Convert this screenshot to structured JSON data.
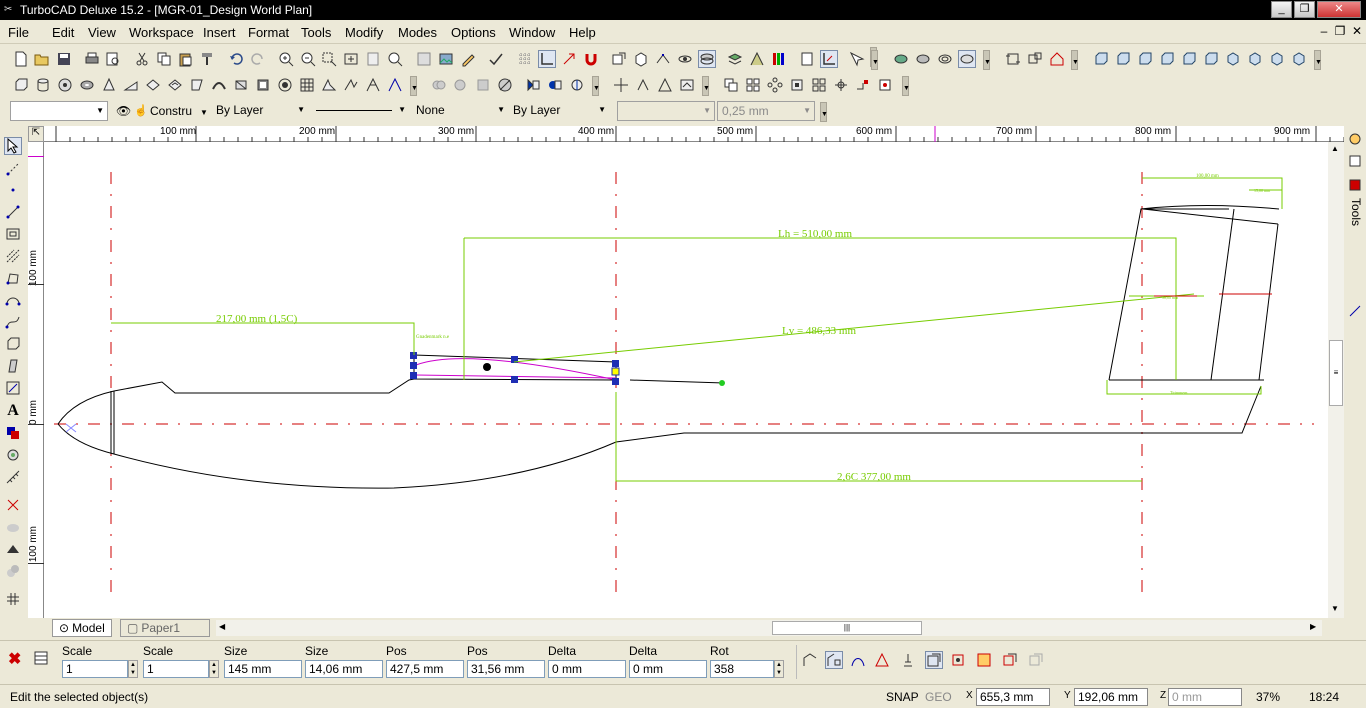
{
  "window": {
    "title": "TurboCAD Deluxe 15.2 - [MGR-01_Design World Plan]",
    "controls": [
      "_",
      "❐",
      "✕"
    ],
    "mdi_controls": [
      "–",
      "❐",
      "✕"
    ]
  },
  "menu": [
    "File",
    "Edit",
    "View",
    "Workspace",
    "Insert",
    "Format",
    "Tools",
    "Modify",
    "Modes",
    "Options",
    "Window",
    "Help"
  ],
  "property_bar": {
    "layer": "",
    "pen_style": "Constru",
    "color": "By Layer",
    "line_type": "",
    "fill": "None",
    "width_mode": "By Layer",
    "combo6": "",
    "width": "0,25 mm"
  },
  "ruler_top": [
    "100 mm",
    "200 mm",
    "300 mm",
    "400 mm",
    "500 mm",
    "600 mm",
    "700 mm",
    "800 mm",
    "900 mm"
  ],
  "ruler_left": [
    "100 mm",
    "0 mm",
    "100 mm"
  ],
  "drawing": {
    "dim_front": "217,00 mm (1,5C)",
    "dim_front_small": "Gnadenmark n.e",
    "dim_lh": "Lh = 510,00 mm",
    "dim_lv": "Lv = 486,33 mm",
    "dim_c": "2,6C 377,00 mm",
    "dim_tail_top": "100,00 mm",
    "dim_tail_small": "15,00 mm",
    "dim_tail_mid": "50,00 mm",
    "dim_tail_bottom": "Ttrimmern"
  },
  "tabs": [
    "Model",
    "Paper1"
  ],
  "inspector": {
    "fields": [
      {
        "label": "Scale X",
        "value": "1"
      },
      {
        "label": "Scale Y",
        "value": "1"
      },
      {
        "label": "Size X",
        "value": "145 mm"
      },
      {
        "label": "Size Y",
        "value": "14,06 mm"
      },
      {
        "label": "Pos X",
        "value": "427,5 mm"
      },
      {
        "label": "Pos Y",
        "value": "31,56 mm"
      },
      {
        "label": "Delta X",
        "value": "0 mm"
      },
      {
        "label": "Delta Y",
        "value": "0 mm"
      },
      {
        "label": "Rot",
        "value": "358"
      }
    ]
  },
  "status": {
    "message": "Edit the selected object(s)",
    "snap": "SNAP",
    "geo": "GEO",
    "x": "655,3 mm",
    "y": "192,06 mm",
    "z": "0 mm",
    "zoom": "37%",
    "time": "18:24"
  },
  "right_panel": {
    "label": "Tools"
  }
}
